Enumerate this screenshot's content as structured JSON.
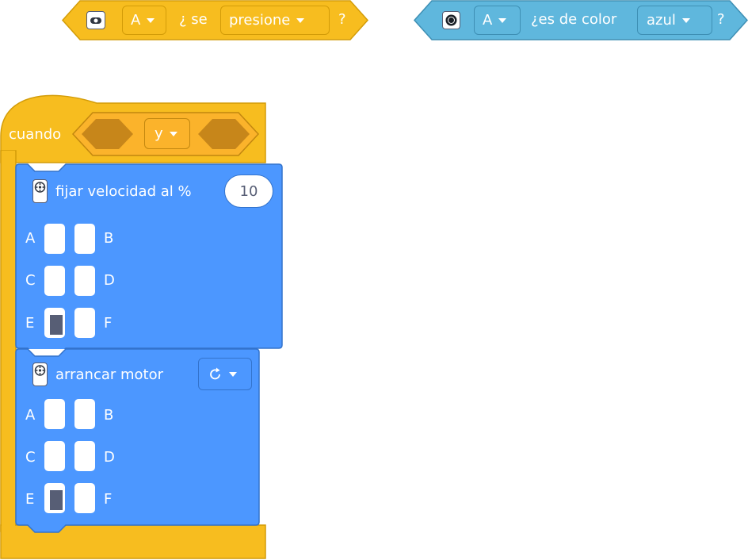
{
  "touch_block": {
    "icon": "force-sensor-icon",
    "port": "A",
    "label_mid": "¿ se",
    "mode": "presione",
    "label_end": "?"
  },
  "color_block": {
    "icon": "color-sensor-icon",
    "port": "A",
    "label_mid": "¿es de color",
    "color": "azul",
    "label_end": "?"
  },
  "cuando_block": {
    "label": "cuando",
    "operator": "y"
  },
  "speed_block": {
    "icon": "motor-icon",
    "label": "fijar velocidad al %",
    "value": "10",
    "ports": [
      "A",
      "B",
      "C",
      "D",
      "E",
      "F"
    ],
    "selected_port": "E"
  },
  "start_block": {
    "icon": "motor-icon",
    "label": "arrancar motor",
    "direction_icon": "clockwise-arrow-icon",
    "ports": [
      "A",
      "B",
      "C",
      "D",
      "E",
      "F"
    ],
    "selected_port": "E"
  },
  "colors": {
    "events_yellow": "#f7bd1f",
    "operator_orange": "#fbb32b",
    "sensor_blue": "#5fb7dd",
    "motor_blue": "#4c97ff"
  }
}
